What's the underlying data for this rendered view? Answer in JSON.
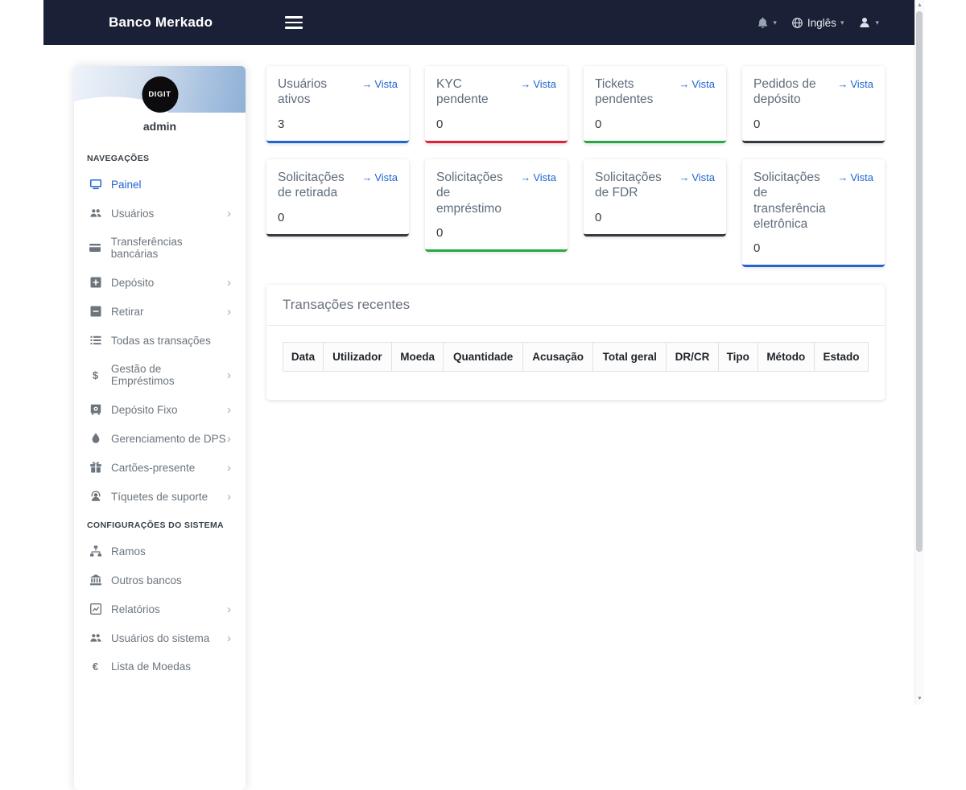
{
  "navbar": {
    "brand": "Banco Merkado",
    "language": "Inglês"
  },
  "sidebar": {
    "logo_text": "DIGIT",
    "username": "admin",
    "sections": [
      {
        "label": "NAVEGAÇÕES",
        "items": [
          {
            "label": "Painel"
          },
          {
            "label": "Usuários"
          },
          {
            "label": "Transferências bancárias"
          },
          {
            "label": "Depósito"
          },
          {
            "label": "Retirar"
          },
          {
            "label": "Todas as transações"
          },
          {
            "label": "Gestão de Empréstimos"
          },
          {
            "label": "Depósito Fixo"
          },
          {
            "label": "Gerenciamento de DPS"
          },
          {
            "label": "Cartões-presente"
          },
          {
            "label": "Tíquetes de suporte"
          }
        ]
      },
      {
        "label": "CONFIGURAÇÕES DO SISTEMA",
        "items": [
          {
            "label": "Ramos"
          },
          {
            "label": "Outros bancos"
          },
          {
            "label": "Relatórios"
          },
          {
            "label": "Usuários do sistema"
          },
          {
            "label": "Lista de Moedas"
          }
        ]
      }
    ]
  },
  "cards": {
    "link_label": "Vista",
    "items": [
      {
        "title": "Usuários ativos",
        "value": "3",
        "accent": "#2065d1"
      },
      {
        "title": "KYC pendente",
        "value": "0",
        "accent": "#e0223b"
      },
      {
        "title": "Tickets pendentes",
        "value": "0",
        "accent": "#28a745"
      },
      {
        "title": "Pedidos de depósito",
        "value": "0",
        "accent": "#343a40"
      },
      {
        "title": "Solicitações de retirada",
        "value": "0",
        "accent": "#343a40"
      },
      {
        "title": "Solicitações de empréstimo",
        "value": "0",
        "accent": "#28a745"
      },
      {
        "title": "Solicitações de FDR",
        "value": "0",
        "accent": "#343a40"
      },
      {
        "title": "Solicitações de transferência eletrônica",
        "value": "0",
        "accent": "#2065d1"
      }
    ]
  },
  "transactions": {
    "title": "Transações recentes",
    "columns": [
      "Data",
      "Utilizador",
      "Moeda",
      "Quantidade",
      "Acusação",
      "Total geral",
      "DR/CR",
      "Tipo",
      "Método",
      "Estado"
    ]
  },
  "colors": {
    "navbar_bg": "#1a2036",
    "primary": "#2065d1",
    "danger": "#e0223b",
    "success": "#28a745",
    "dark": "#343a40"
  }
}
